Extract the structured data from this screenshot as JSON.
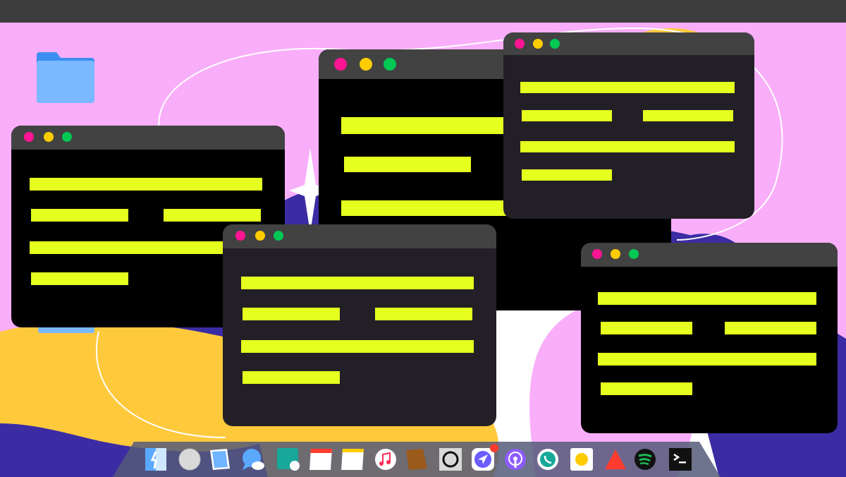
{
  "colors": {
    "wallpaper": "#f9aef9",
    "menubar": "#3d3d3d",
    "window_body": "#000000",
    "window_titlebar": "#424242",
    "text_bar": "#e5ff1f",
    "dot_close": "#ff1493",
    "dot_minimize": "#ffcc00",
    "dot_maximize": "#00c853",
    "dock": "#555a7a"
  },
  "desktop": {
    "icons": [
      {
        "name": "folder-icon"
      },
      {
        "name": "folder-icon"
      }
    ]
  },
  "windows": [
    {
      "name": "terminal-window-left",
      "controls": [
        "close-dot",
        "minimize-dot",
        "maximize-dot"
      ]
    },
    {
      "name": "terminal-window-center-back",
      "controls": [
        "close-dot",
        "minimize-dot",
        "maximize-dot"
      ]
    },
    {
      "name": "terminal-window-top-right",
      "controls": [
        "close-dot",
        "minimize-dot",
        "maximize-dot"
      ]
    },
    {
      "name": "terminal-window-center-front",
      "controls": [
        "close-dot",
        "minimize-dot",
        "maximize-dot"
      ]
    },
    {
      "name": "terminal-window-bottom-right",
      "controls": [
        "close-dot",
        "minimize-dot",
        "maximize-dot"
      ]
    }
  ],
  "dock": {
    "apps": [
      {
        "icon": "finder-icon"
      },
      {
        "icon": "circle-app-icon"
      },
      {
        "icon": "preview-icon"
      },
      {
        "icon": "messages-icon"
      },
      {
        "icon": "facetime-icon"
      },
      {
        "icon": "calendar-icon"
      },
      {
        "icon": "notes-icon"
      },
      {
        "icon": "music-icon"
      },
      {
        "icon": "books-icon"
      },
      {
        "icon": "camera-icon"
      },
      {
        "icon": "navigation-icon",
        "badge": true
      },
      {
        "icon": "podcasts-icon"
      },
      {
        "icon": "whatsapp-icon"
      },
      {
        "icon": "yellow-dot-app-icon"
      },
      {
        "icon": "warning-triangle-icon"
      },
      {
        "icon": "spotify-icon"
      },
      {
        "icon": "terminal-icon"
      }
    ]
  }
}
